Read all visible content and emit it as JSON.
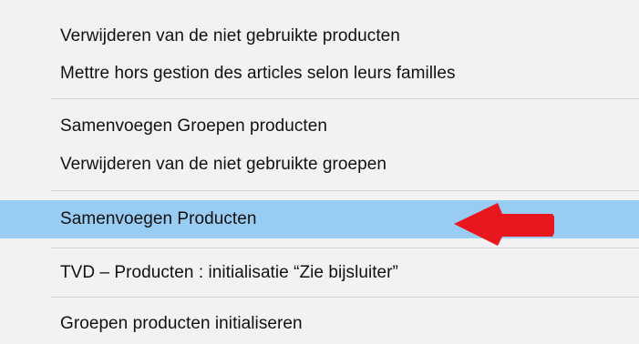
{
  "menu": {
    "items": [
      {
        "label": "Verwijderen van de niet gebruikte producten"
      },
      {
        "label": "Mettre hors gestion des articles selon leurs familles"
      },
      {
        "label": "Samenvoegen Groepen producten"
      },
      {
        "label": "Verwijderen van de niet gebruikte groepen"
      },
      {
        "label": "Samenvoegen Producten"
      },
      {
        "label": "TVD – Producten : initialisatie “Zie bijsluiter”"
      },
      {
        "label": "Groepen producten initialiseren"
      }
    ],
    "highlighted_index": 4
  },
  "annotation": {
    "icon": "left-arrow-icon",
    "color": "#e8161d"
  },
  "colors": {
    "highlight": "#99ccf3",
    "background": "#f2f2f2",
    "separator": "#d4d4d4"
  }
}
